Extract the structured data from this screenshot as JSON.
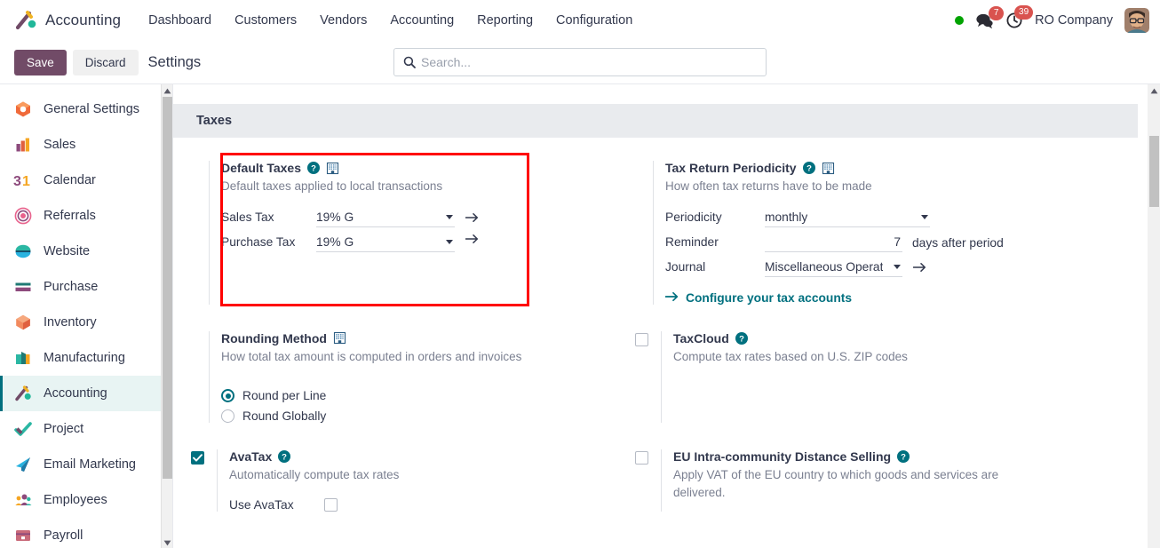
{
  "navbar": {
    "brand": "Accounting",
    "menu": [
      {
        "label": "Dashboard"
      },
      {
        "label": "Customers"
      },
      {
        "label": "Vendors"
      },
      {
        "label": "Accounting"
      },
      {
        "label": "Reporting"
      },
      {
        "label": "Configuration"
      }
    ],
    "status_color": "#00a300",
    "messages_count": "7",
    "activities_count": "39",
    "company": "RO Company"
  },
  "control_panel": {
    "save_label": "Save",
    "discard_label": "Discard",
    "title": "Settings",
    "search_placeholder": "Search..."
  },
  "sidebar": {
    "items": [
      {
        "label": "General Settings",
        "icon": "general-settings-icon",
        "active": false
      },
      {
        "label": "Sales",
        "icon": "sales-icon",
        "active": false
      },
      {
        "label": "Calendar",
        "icon": "calendar-icon",
        "active": false
      },
      {
        "label": "Referrals",
        "icon": "referrals-icon",
        "active": false
      },
      {
        "label": "Website",
        "icon": "website-icon",
        "active": false
      },
      {
        "label": "Purchase",
        "icon": "purchase-icon",
        "active": false
      },
      {
        "label": "Inventory",
        "icon": "inventory-icon",
        "active": false
      },
      {
        "label": "Manufacturing",
        "icon": "manufacturing-icon",
        "active": false
      },
      {
        "label": "Accounting",
        "icon": "accounting-icon",
        "active": true
      },
      {
        "label": "Project",
        "icon": "project-icon",
        "active": false
      },
      {
        "label": "Email Marketing",
        "icon": "email-marketing-icon",
        "active": false
      },
      {
        "label": "Employees",
        "icon": "employees-icon",
        "active": false
      },
      {
        "label": "Payroll",
        "icon": "payroll-icon",
        "active": false
      }
    ]
  },
  "main": {
    "section_title": "Taxes",
    "default_taxes": {
      "title": "Default Taxes",
      "subtitle": "Default taxes applied to local transactions",
      "sales_tax_label": "Sales Tax",
      "sales_tax_value": "19% G",
      "purchase_tax_label": "Purchase Tax",
      "purchase_tax_value": "19% G"
    },
    "tax_return_periodicity": {
      "title": "Tax Return Periodicity",
      "subtitle": "How often tax returns have to be made",
      "periodicity_label": "Periodicity",
      "periodicity_value": "monthly",
      "reminder_label": "Reminder",
      "reminder_value": "7",
      "reminder_unit": "days after period",
      "journal_label": "Journal",
      "journal_value": "Miscellaneous Operat",
      "configure_link": "Configure your tax accounts"
    },
    "rounding_method": {
      "title": "Rounding Method",
      "subtitle": "How total tax amount is computed in orders and invoices",
      "option_per_line": "Round per Line",
      "option_globally": "Round Globally",
      "selected": "Round per Line"
    },
    "taxcloud": {
      "title": "TaxCloud",
      "subtitle": "Compute tax rates based on U.S. ZIP codes",
      "checked": false
    },
    "avatax": {
      "title": "AvaTax",
      "subtitle": "Automatically compute tax rates",
      "checked": true,
      "use_avatax_label": "Use AvaTax",
      "use_avatax_checked": false
    },
    "eu_distance_selling": {
      "title": "EU Intra-community Distance Selling",
      "subtitle": "Apply VAT of the EU country to which goods and services are delivered.",
      "checked": false
    }
  },
  "annotation": {
    "highlight_color": "#ff0000"
  }
}
